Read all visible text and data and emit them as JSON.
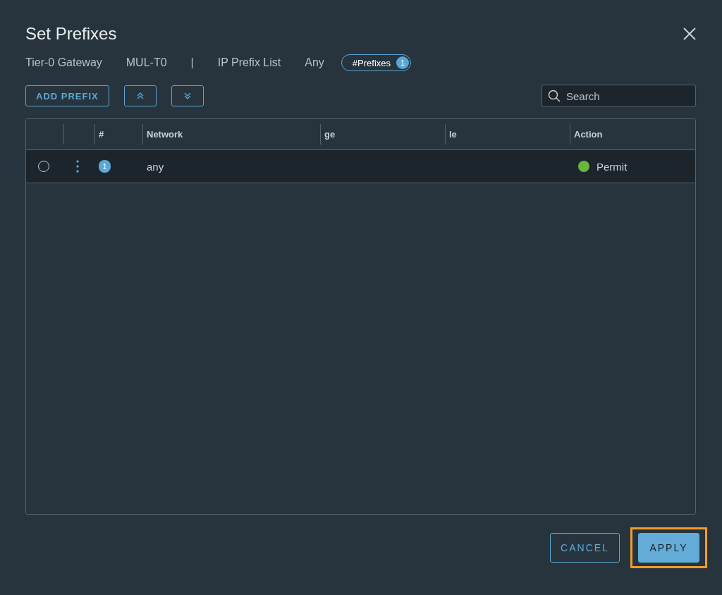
{
  "dialog": {
    "title": "Set Prefixes"
  },
  "breadcrumb": [
    {
      "kind": "text",
      "label": "Tier-0 Gateway"
    },
    {
      "kind": "text",
      "label": "MUL-T0"
    },
    {
      "kind": "separator",
      "label": "|"
    },
    {
      "kind": "text",
      "label": "IP Prefix List"
    },
    {
      "kind": "text",
      "label": "Any"
    },
    {
      "kind": "pill",
      "label": "#Prefixes",
      "count": "1"
    }
  ],
  "toolbar": {
    "add_button": "ADD PREFIX",
    "search": {
      "placeholder": "Search"
    }
  },
  "table": {
    "columns": [
      "#",
      "Network",
      "ge",
      "le",
      "Action"
    ],
    "rows": [
      {
        "selected": false,
        "number": "1",
        "network": "any",
        "action": "Permit",
        "color": "#6cb33f"
      }
    ]
  },
  "footer": {
    "buttons": [
      {
        "label": "CANCEL",
        "kind": "secondary",
        "highlighted": false
      },
      {
        "label": "APPLY",
        "kind": "primary",
        "highlighted": true
      }
    ]
  }
}
